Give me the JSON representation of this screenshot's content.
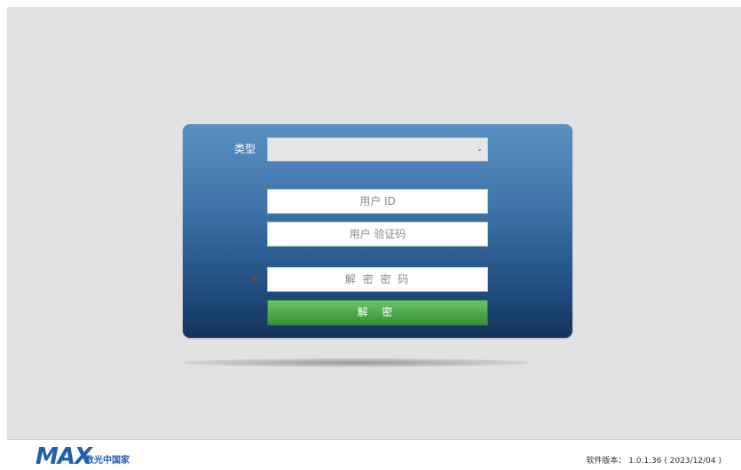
{
  "login": {
    "type_label": "类型",
    "type_select_value": "",
    "user_id_placeholder": "用户 ID",
    "verify_code_placeholder": "用户 验证码",
    "required_mark": "*",
    "decrypt_password_placeholder": "解 密 密 码",
    "decrypt_button_label": "解 密"
  },
  "footer": {
    "logo_text": "MAX",
    "logo_subtext": "数光中国家",
    "version_text": "软件版本：  1.0.1.36  ( 2023/12/04 )"
  },
  "colors": {
    "page_background": "#e2e2e2",
    "panel_top": "#5a90c2",
    "panel_bottom": "#13335a",
    "button_green": "#4eaa4d",
    "required_red": "#e0281e",
    "logo_blue": "#1f5fb0"
  },
  "icons": {
    "select_arrow": "chevron-down-icon"
  }
}
